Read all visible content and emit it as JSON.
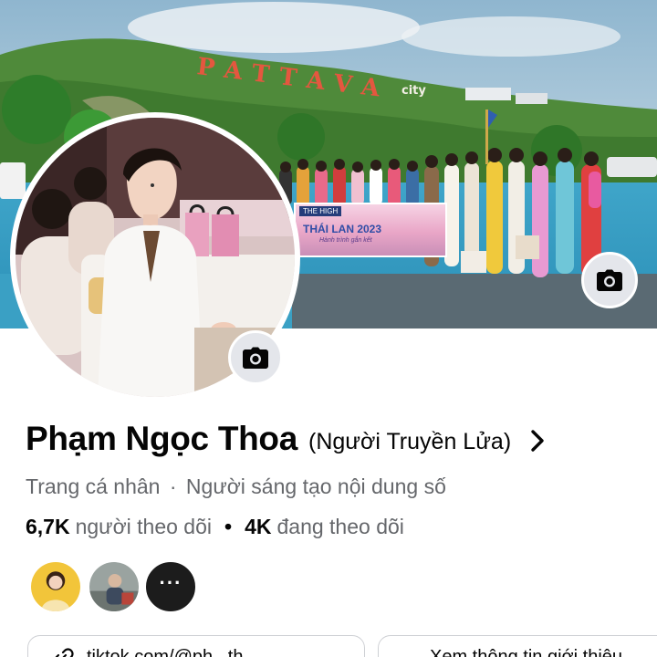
{
  "cover": {
    "sign_text": "PATTAVA",
    "sign_city": "city",
    "banner_brand": "THE HIGH",
    "banner_title": "THÁI LAN 2023",
    "banner_sub": "Hành trình gắn kết",
    "camera_icon": "camera-icon"
  },
  "avatar": {
    "camera_icon": "camera-icon"
  },
  "profile": {
    "name": "Phạm Ngọc Thoa",
    "alternate_name": "(Người Truyền Lửa)",
    "chevron_icon": "chevron-right-icon",
    "category_page": "Trang cá nhân",
    "separator": "·",
    "category": "Người sáng tạo nội dung số",
    "followers_count": "6,7K",
    "followers_label": "người theo dõi",
    "stats_separator": "•",
    "following_count": "4K",
    "following_label": "đang theo dõi"
  },
  "followers_preview": {
    "more_label": "···"
  },
  "actions": {
    "link_label": "tiktok.com/@ph...th...",
    "intro_label": "Xem thông tin giới thiệu"
  },
  "colors": {
    "primary_text": "#050505",
    "secondary_text": "#65676b",
    "icon_bg": "#e4e6eb",
    "border": "#ced0d4"
  }
}
